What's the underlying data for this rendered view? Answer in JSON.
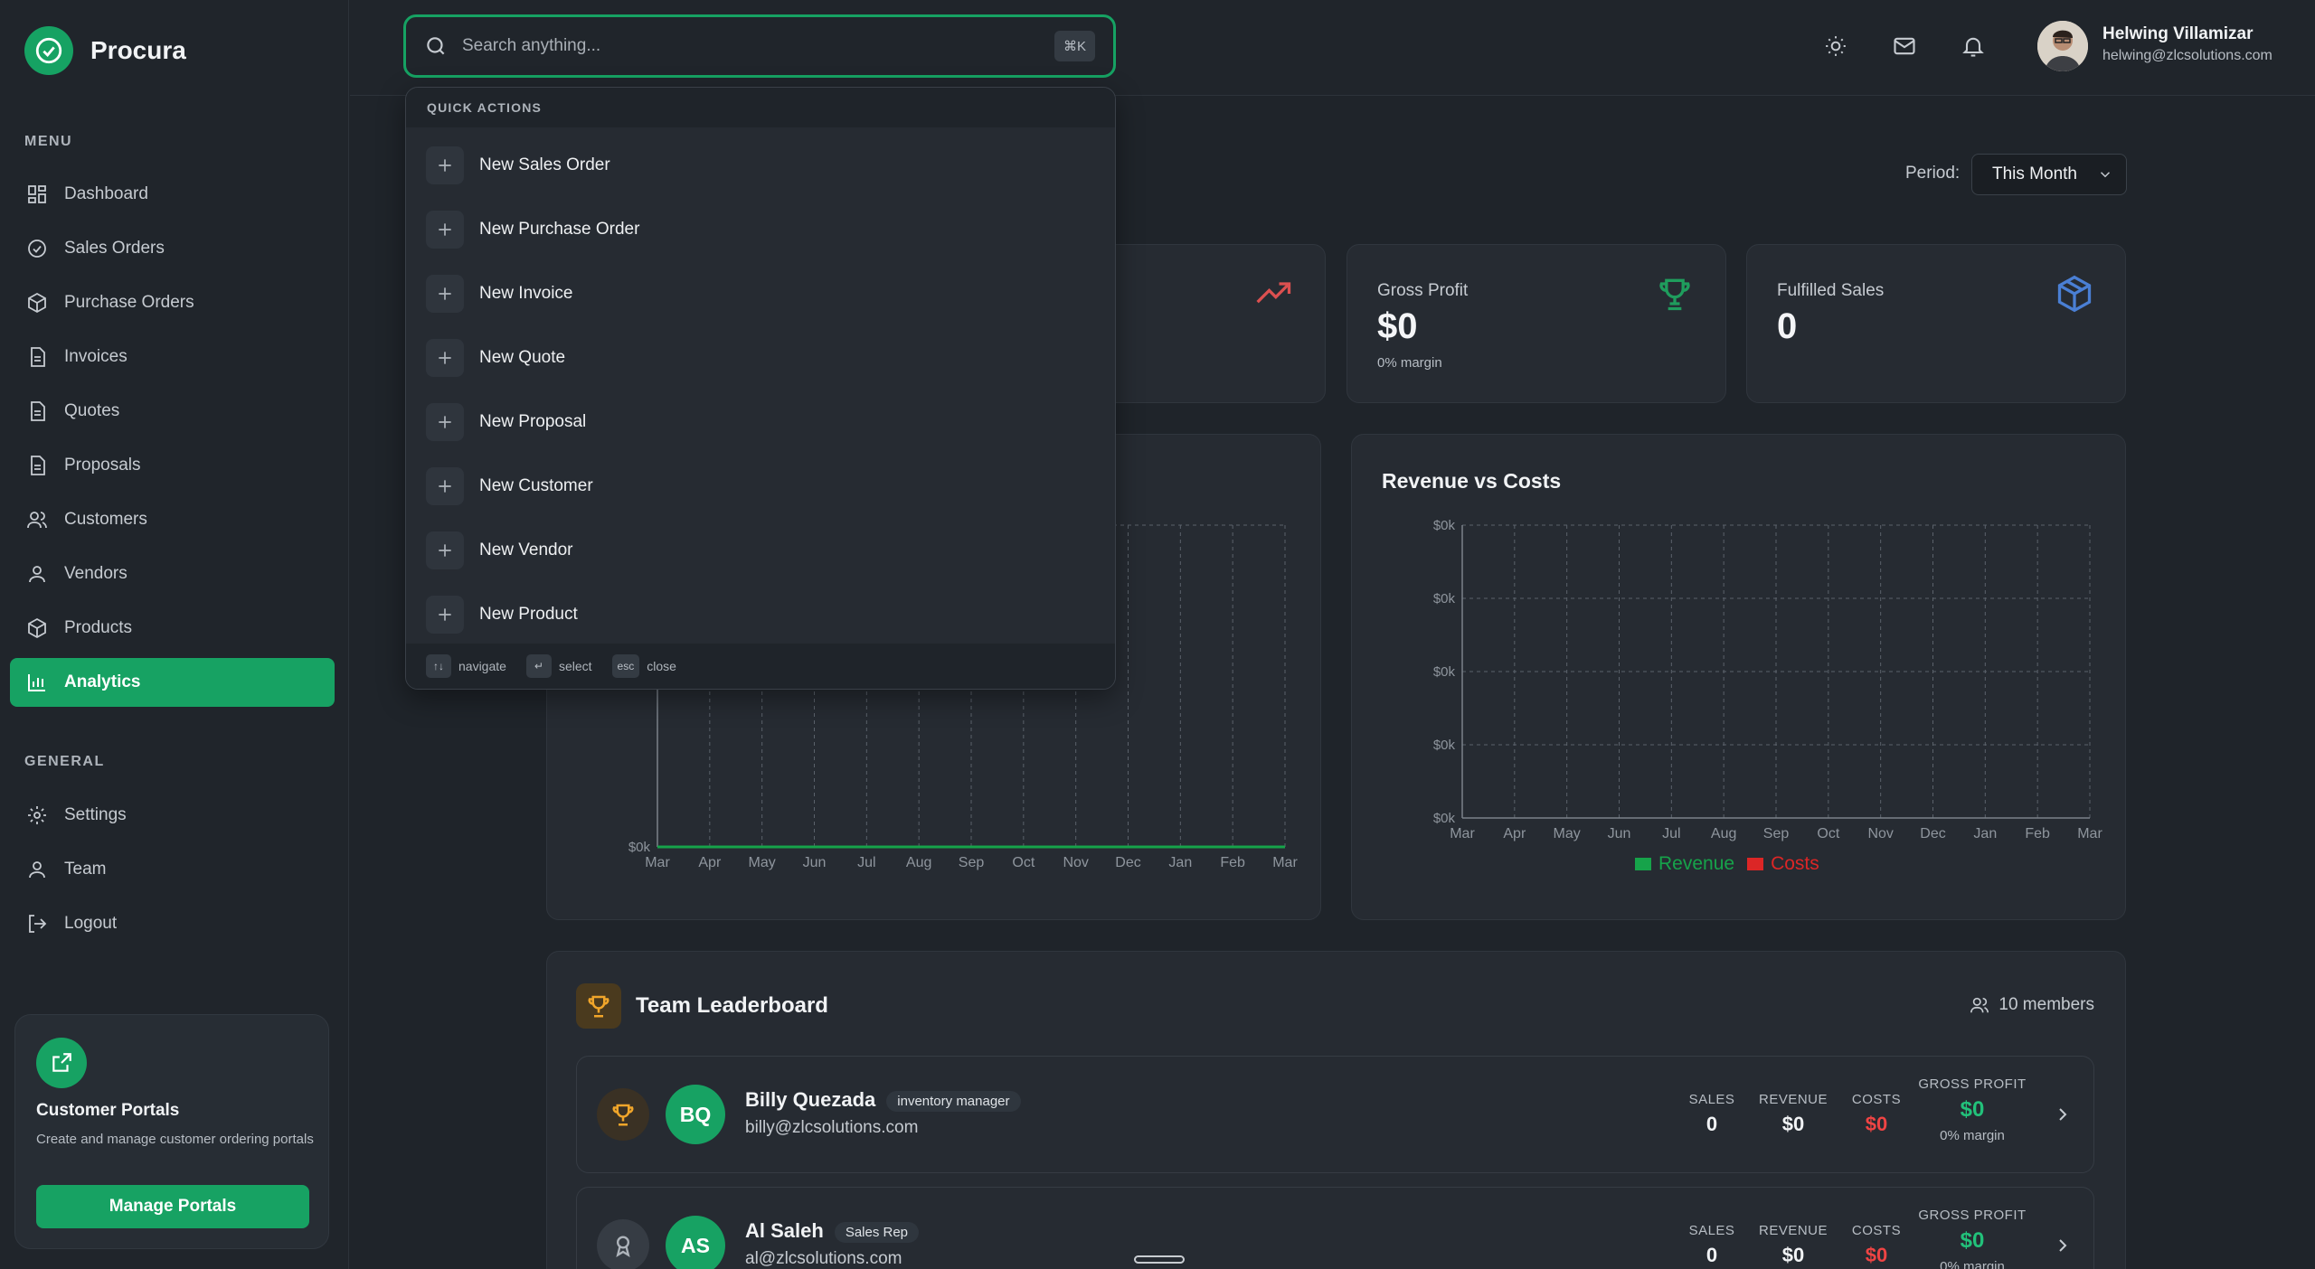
{
  "brand": {
    "name": "Procura"
  },
  "sidebar": {
    "menu_label": "MENU",
    "general_label": "GENERAL",
    "items": [
      {
        "label": "Dashboard",
        "icon": "grid-icon"
      },
      {
        "label": "Sales Orders",
        "icon": "check-circle-icon"
      },
      {
        "label": "Purchase Orders",
        "icon": "package-icon"
      },
      {
        "label": "Invoices",
        "icon": "file-icon"
      },
      {
        "label": "Quotes",
        "icon": "file-icon"
      },
      {
        "label": "Proposals",
        "icon": "file-icon"
      },
      {
        "label": "Customers",
        "icon": "users-icon"
      },
      {
        "label": "Vendors",
        "icon": "user-icon"
      },
      {
        "label": "Products",
        "icon": "package-icon"
      },
      {
        "label": "Analytics",
        "icon": "bar-chart-icon",
        "active": true
      }
    ],
    "general": [
      {
        "label": "Settings",
        "icon": "gear-icon"
      },
      {
        "label": "Team",
        "icon": "user-icon"
      },
      {
        "label": "Logout",
        "icon": "logout-icon"
      }
    ],
    "promo": {
      "title": "Customer Portals",
      "description": "Create and manage customer ordering portals",
      "button": "Manage Portals"
    }
  },
  "header": {
    "search_placeholder": "Search anything...",
    "search_shortcut": "⌘K",
    "user_name": "Helwing Villamizar",
    "user_email": "helwing@zlcsolutions.com"
  },
  "quick_actions": {
    "title": "QUICK ACTIONS",
    "items": [
      "New Sales Order",
      "New Purchase Order",
      "New Invoice",
      "New Quote",
      "New Proposal",
      "New Customer",
      "New Vendor",
      "New Product"
    ],
    "hints": [
      {
        "key": "↑↓",
        "label": "navigate"
      },
      {
        "key": "↵",
        "label": "select"
      },
      {
        "key": "esc",
        "label": "close"
      }
    ]
  },
  "period": {
    "label": "Period:",
    "value": "This Month"
  },
  "stats": {
    "gross_profit": {
      "title": "Gross Profit",
      "value": "$0",
      "sub": "0% margin"
    },
    "fulfilled_sales": {
      "title": "Fulfilled Sales",
      "value": "0"
    }
  },
  "colors": {
    "accent": "#17a263",
    "revenue": "#16a34a",
    "costs": "#dc2626",
    "profit": "#22c17a",
    "loss": "#ef4444"
  },
  "chart_data": [
    {
      "type": "line",
      "title": "",
      "categories": [
        "Mar",
        "Apr",
        "May",
        "Jun",
        "Jul",
        "Aug",
        "Sep",
        "Oct",
        "Nov",
        "Dec",
        "Jan",
        "Feb",
        "Mar"
      ],
      "ytick_labels": [
        "$0k",
        "$0k"
      ],
      "series": [
        {
          "values": [
            0,
            0,
            0,
            0,
            0,
            0,
            0,
            0,
            0,
            0,
            0,
            0,
            0
          ]
        }
      ]
    },
    {
      "type": "bar",
      "title": "Revenue vs Costs",
      "categories": [
        "Mar",
        "Apr",
        "May",
        "Jun",
        "Jul",
        "Aug",
        "Sep",
        "Oct",
        "Nov",
        "Dec",
        "Jan",
        "Feb",
        "Mar"
      ],
      "ytick_labels": [
        "$0k",
        "$0k",
        "$0k",
        "$0k",
        "$0k"
      ],
      "series": [
        {
          "name": "Revenue",
          "values": [
            0,
            0,
            0,
            0,
            0,
            0,
            0,
            0,
            0,
            0,
            0,
            0,
            0
          ]
        },
        {
          "name": "Costs",
          "values": [
            0,
            0,
            0,
            0,
            0,
            0,
            0,
            0,
            0,
            0,
            0,
            0,
            0
          ]
        }
      ],
      "legend": "bottom"
    }
  ],
  "leaderboard": {
    "title": "Team Leaderboard",
    "members": "10 members",
    "labels": {
      "sales": "SALES",
      "revenue": "REVENUE",
      "costs": "COSTS",
      "gross_profit": "GROSS PROFIT"
    },
    "rows": [
      {
        "initials": "BQ",
        "name": "Billy Quezada",
        "role": "inventory manager",
        "email": "billy@zlcsolutions.com",
        "sales": "0",
        "revenue": "$0",
        "costs": "$0",
        "gross_profit": "$0",
        "margin": "0% margin"
      },
      {
        "initials": "AS",
        "name": "Al Saleh",
        "role": "Sales Rep",
        "email": "al@zlcsolutions.com",
        "sales": "0",
        "revenue": "$0",
        "costs": "$0",
        "gross_profit": "$0",
        "margin": "0% margin"
      }
    ]
  }
}
